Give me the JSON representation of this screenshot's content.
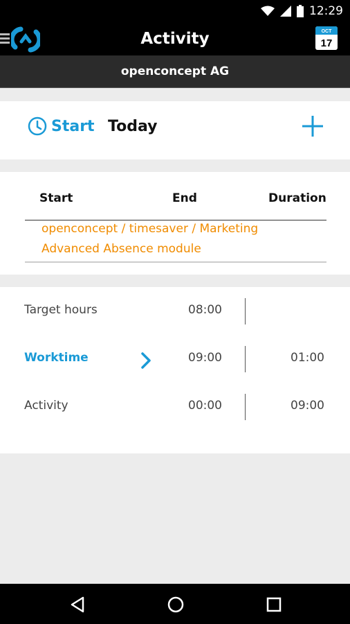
{
  "status_bar": {
    "time": "12:29"
  },
  "app_bar": {
    "title": "Activity",
    "calendar": {
      "month": "OCT",
      "day": "17"
    }
  },
  "sub_bar": {
    "company": "openconcept AG"
  },
  "start_section": {
    "start_label": "Start",
    "date_label": "Today"
  },
  "list": {
    "headers": {
      "start": "Start",
      "end": "End",
      "duration": "Duration"
    },
    "entries": [
      "openconcept / timesaver / Marketing",
      "Advanced Absence module"
    ]
  },
  "summary": {
    "rows": [
      {
        "label": "Target hours",
        "value1": "08:00",
        "value2": ""
      },
      {
        "label": "Worktime",
        "value1": "09:00",
        "value2": "01:00"
      },
      {
        "label": "Activity",
        "value1": "00:00",
        "value2": "09:00"
      }
    ]
  },
  "colors": {
    "accent": "#1a9ad6",
    "entry": "#f08c00",
    "bar": "#000000"
  }
}
